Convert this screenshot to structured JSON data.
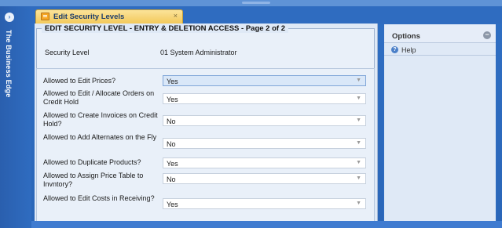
{
  "app": {
    "rail_title": "The Business Edge"
  },
  "tab": {
    "label": "Edit Security Levels",
    "close": "×"
  },
  "form": {
    "legend": "EDIT SECURITY LEVEL - ENTRY & DELETION ACCESS - Page 2 of 2",
    "security_level_label": "Security Level",
    "security_level_value": "01 System Administrator",
    "rows": [
      {
        "label": "Allowed to Edit Prices?",
        "value": "Yes"
      },
      {
        "label": "Allowed to Edit / Allocate Orders on Credit Hold",
        "value": "Yes"
      },
      {
        "label": "Allowed to Create Invoices on Credit Hold?",
        "value": "No"
      },
      {
        "label": "Allowed to Add Alternates on the Fly",
        "value": "No"
      },
      {
        "label": "Allowed to Duplicate Products?",
        "value": "Yes"
      },
      {
        "label": "Allowed to Assign Price Table to Invntory?",
        "value": "No"
      },
      {
        "label": "Allowed to Edit Costs in Receiving?",
        "value": "Yes"
      }
    ]
  },
  "options": {
    "title": "Options",
    "help_label": "Help"
  },
  "icons": {
    "rail_button": "circle-arrow-icon",
    "tab_icon": "edit-document-icon",
    "collapse": "minus-circle-icon",
    "help": "help-icon",
    "dropdown": "chevron-down-icon"
  },
  "colors": {
    "accent": "#2f6cc0",
    "tab": "#f3c95a",
    "panel": "#dfe9f6"
  }
}
